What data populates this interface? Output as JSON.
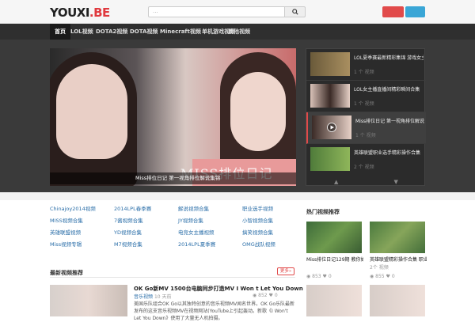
{
  "header": {
    "logo_main": "YOUXI",
    "logo_tld": ".BE",
    "search_placeholder": "...",
    "search_icon": "search-icon"
  },
  "nav": {
    "items": [
      "首页",
      "LOL视频",
      "DOTA2视频",
      "DOTA视频",
      "Minecraft视频",
      "单机游戏视频",
      "其他视频"
    ]
  },
  "hero": {
    "watermark": "MISS排位日记",
    "caption": "Miss排位日记 第一视角排位解说集锦"
  },
  "sidebar": {
    "items": [
      {
        "title": "LOL夏季赛最新精彩集锦 游戏女主播COS专辑",
        "meta": "1 个 视频"
      },
      {
        "title": "LOL女主播直播间精彩瞬间合集",
        "meta": "1 个 视频"
      },
      {
        "title": "Miss排位日记 第一视角排位解说",
        "meta": "1 个 视频"
      },
      {
        "title": "英雄联盟职业选手精彩操作合集",
        "meta": "2 个 视频"
      }
    ],
    "up_arrow": "▲",
    "down_arrow": "▼"
  },
  "categories": [
    [
      "Chinajoy2014视频",
      "2014LPL春季赛",
      "解说视频合集",
      "职业选手视频"
    ],
    [
      "MISS视频合集",
      "7酱视频合集",
      "JY视频合集",
      "小智视频合集"
    ],
    [
      "英雄联盟视频",
      "YD视频合集",
      "电竞女主播视频",
      "搞笑视频合集"
    ],
    [
      "Miss视频专辑",
      "M7视频合集",
      "2014LPL夏季赛",
      "OMG战队视频"
    ]
  ],
  "right_section": {
    "title": "热门视频推荐",
    "items": [
      {
        "caption": "Miss排位日记129期 教你如何 5杀",
        "meta_views": "853",
        "meta_likes": "0"
      },
      {
        "caption": "英雄联盟精彩操作合集 职业选手第一视角",
        "meta_views": "855",
        "meta_likes": "0"
      }
    ],
    "item_sub": "2个 视频"
  },
  "latest": {
    "title": "最新视频推荐",
    "more_label": "更多»",
    "article": {
      "title": "OK Go新MV 1500台电脑同步打造MV I Won t Let You Down",
      "tag": "音乐视频",
      "date": "10 天前",
      "views": "852",
      "likes": "0",
      "desc": "美国乐队组合OK Go以其独特创意的音乐视频MV闻名世界。OK Go乐队最新发布的这支音乐视频MV在视频网站(YouTube上引起轰动。新歌《I Won't Let You Down》使用了大量无人机拍摄。"
    }
  },
  "colors": {
    "accent_red": "#e14a4a",
    "accent_blue": "#3aa6d6",
    "nav_bg": "#2f2f2f",
    "link": "#2a6ea8"
  }
}
